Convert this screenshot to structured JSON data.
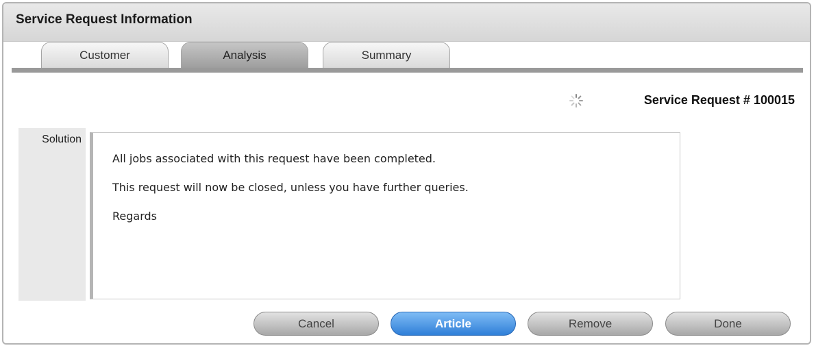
{
  "window": {
    "title": "Service Request Information"
  },
  "tabs": [
    {
      "label": "Customer"
    },
    {
      "label": "Analysis",
      "active": true
    },
    {
      "label": "Summary"
    }
  ],
  "header": {
    "request_number": "Service Request # 100015",
    "loading_icon": "spinner-icon"
  },
  "solution": {
    "label": "Solution",
    "lines": [
      "All jobs associated with this request have been completed.",
      "This request will now be closed, unless you have further queries.",
      "Regards"
    ]
  },
  "buttons": {
    "cancel": "Cancel",
    "article": "Article",
    "remove": "Remove",
    "done": "Done"
  },
  "colors": {
    "primary_button": "#2f7fd8",
    "tab_bar": "#999999"
  }
}
